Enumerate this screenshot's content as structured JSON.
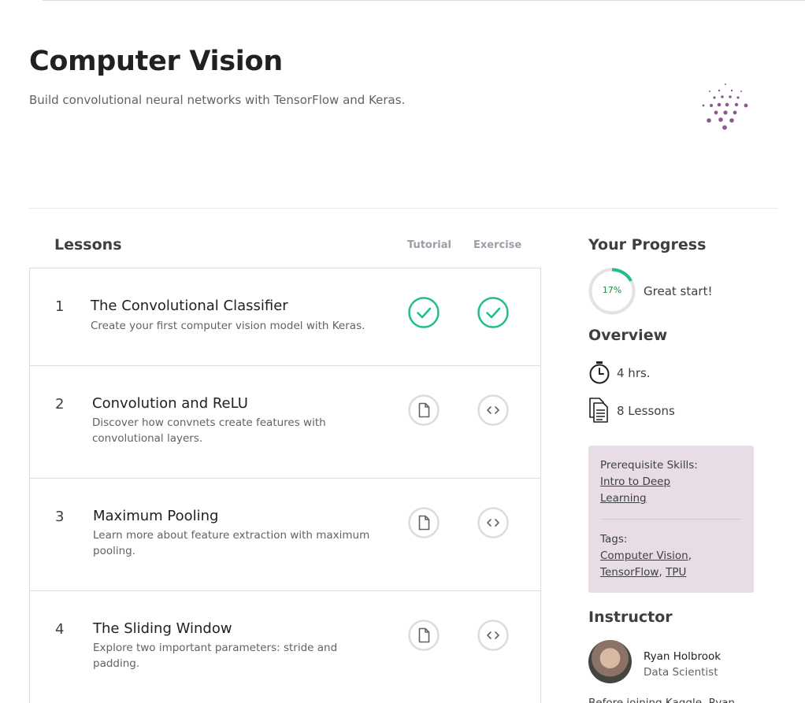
{
  "course": {
    "title": "Computer Vision",
    "subtitle": "Build convolutional neural networks with TensorFlow and Keras."
  },
  "lessons_table": {
    "heading": "Lessons",
    "col_tutorial": "Tutorial",
    "col_exercise": "Exercise",
    "lessons": [
      {
        "num": "1",
        "title": "The Convolutional Classifier",
        "desc": "Create your first computer vision model with Keras.",
        "tutorial_icon": "check-circle-icon",
        "exercise_icon": "check-circle-icon"
      },
      {
        "num": "2",
        "title": "Convolution and ReLU",
        "desc": "Discover how convnets create features with convolutional layers.",
        "tutorial_icon": "document-icon",
        "exercise_icon": "code-icon"
      },
      {
        "num": "3",
        "title": "Maximum Pooling",
        "desc": "Learn more about feature extraction with maximum pooling.",
        "tutorial_icon": "document-icon",
        "exercise_icon": "code-icon"
      },
      {
        "num": "4",
        "title": "The Sliding Window",
        "desc": "Explore two important parameters: stride and padding.",
        "tutorial_icon": "document-icon",
        "exercise_icon": "code-icon"
      }
    ]
  },
  "progress": {
    "heading": "Your Progress",
    "percent_label": "17%",
    "percent_value": 17,
    "message": "Great start!"
  },
  "overview": {
    "heading": "Overview",
    "duration": "4 hrs.",
    "lessons_count": "8 Lessons"
  },
  "prereq": {
    "label": "Prerequisite Skills:",
    "skill_line1": "Intro to Deep",
    "skill_line2": "Learning",
    "tags_label": "Tags:",
    "tag1": "Computer Vision",
    "tag2": "TensorFlow",
    "tag3": "TPU"
  },
  "instructor": {
    "heading": "Instructor",
    "name": "Ryan Holbrook",
    "role": "Data Scientist",
    "bio": "Before joining Kaggle, Ryan"
  },
  "colors": {
    "check_green": "#20BE8F",
    "progress_green": "#20BE8F",
    "prereq_bg": "#E8DDE6",
    "logo_purple": "#8E5A8E"
  }
}
